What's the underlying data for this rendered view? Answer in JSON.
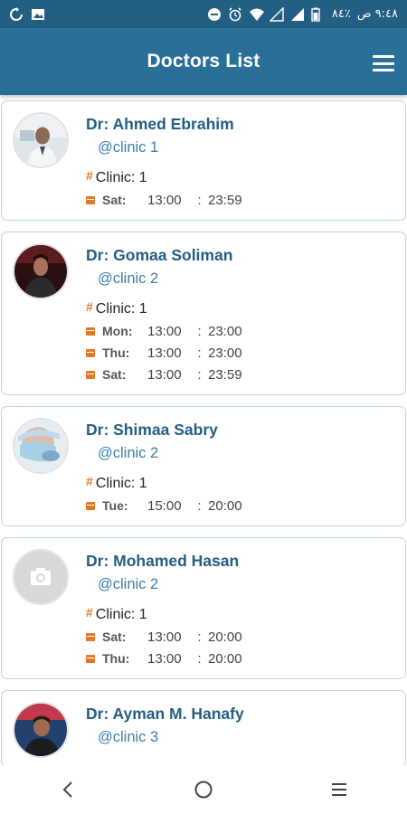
{
  "status_bar": {
    "time": "٩:٤٨ ص",
    "carrier": "٨٤٪",
    "bg_color": "#235e83"
  },
  "app_bar": {
    "title": "Doctors List",
    "bg_color": "#2a6f98"
  },
  "doctors": [
    {
      "name": "Dr: Ahmed Ebrahim",
      "handle": "@clinic 1",
      "clinic": "Clinic: 1",
      "schedule": [
        {
          "day": "Sat:",
          "from": "13:00",
          "sep": ":",
          "to": "23:59"
        }
      ]
    },
    {
      "name": "Dr: Gomaa Soliman",
      "handle": "@clinic 2",
      "clinic": "Clinic: 1",
      "schedule": [
        {
          "day": "Mon:",
          "from": "13:00",
          "sep": ":",
          "to": "23:00"
        },
        {
          "day": "Thu:",
          "from": "13:00",
          "sep": ":",
          "to": "23:00"
        },
        {
          "day": "Sat:",
          "from": "13:00",
          "sep": ":",
          "to": "23:59"
        }
      ]
    },
    {
      "name": "Dr: Shimaa Sabry",
      "handle": "@clinic 2",
      "clinic": "Clinic: 1",
      "schedule": [
        {
          "day": "Tue:",
          "from": "15:00",
          "sep": ":",
          "to": "20:00"
        }
      ]
    },
    {
      "name": "Dr: Mohamed Hasan",
      "handle": "@clinic 2",
      "clinic": "Clinic: 1",
      "schedule": [
        {
          "day": "Sat:",
          "from": "13:00",
          "sep": ":",
          "to": "20:00"
        },
        {
          "day": "Thu:",
          "from": "13:00",
          "sep": ":",
          "to": "20:00"
        }
      ]
    },
    {
      "name": "Dr: Ayman M. Hanafy",
      "handle": "@clinic 3",
      "clinic": "",
      "schedule": []
    }
  ],
  "accent_color": "#e07a2a"
}
